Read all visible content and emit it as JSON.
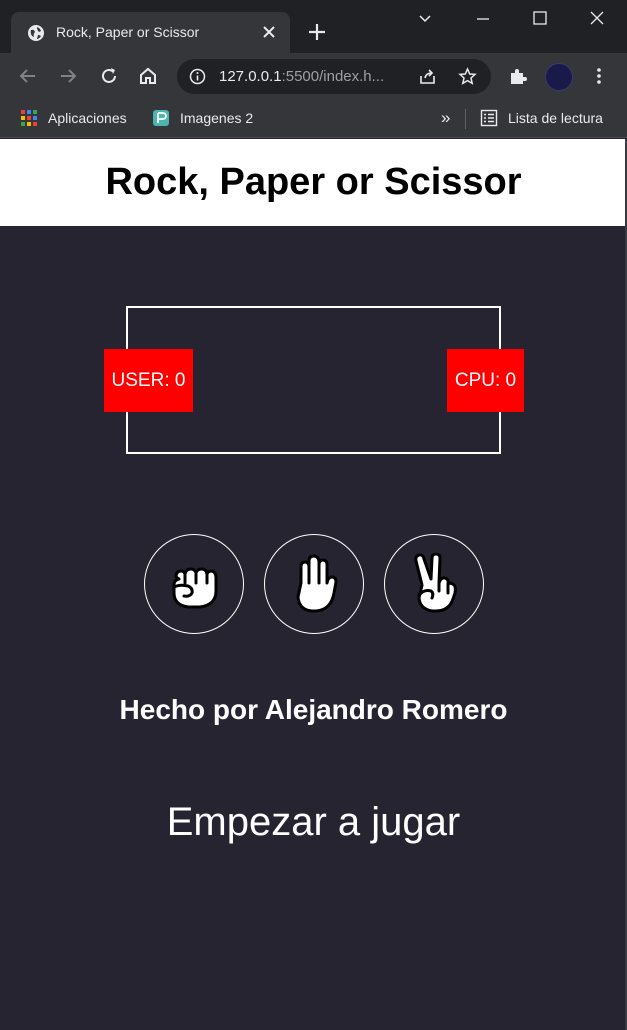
{
  "browser": {
    "tab_title": "Rock, Paper or Scissor",
    "url_host": "127.0.0.1",
    "url_rest": ":5500/index.h...",
    "bookmarks": [
      {
        "label": "Aplicaciones"
      },
      {
        "label": "Imagenes 2"
      }
    ],
    "overflow_label": "»",
    "reading_list_label": "Lista de lectura"
  },
  "game": {
    "title": "Rock, Paper or Scissor",
    "user_score": "USER: 0",
    "cpu_score": "CPU: 0",
    "choices": [
      {
        "name": "rock",
        "icon": "hand-rock-icon"
      },
      {
        "name": "paper",
        "icon": "hand-paper-icon"
      },
      {
        "name": "scissors",
        "icon": "hand-scissors-icon"
      }
    ],
    "credits": "Hecho por Alejandro Romero",
    "start_label": "Empezar a jugar"
  },
  "colors": {
    "page_bg": "#252430",
    "header_bg": "#ffffff",
    "score_bg": "#ff0000",
    "text": "#ffffff"
  }
}
